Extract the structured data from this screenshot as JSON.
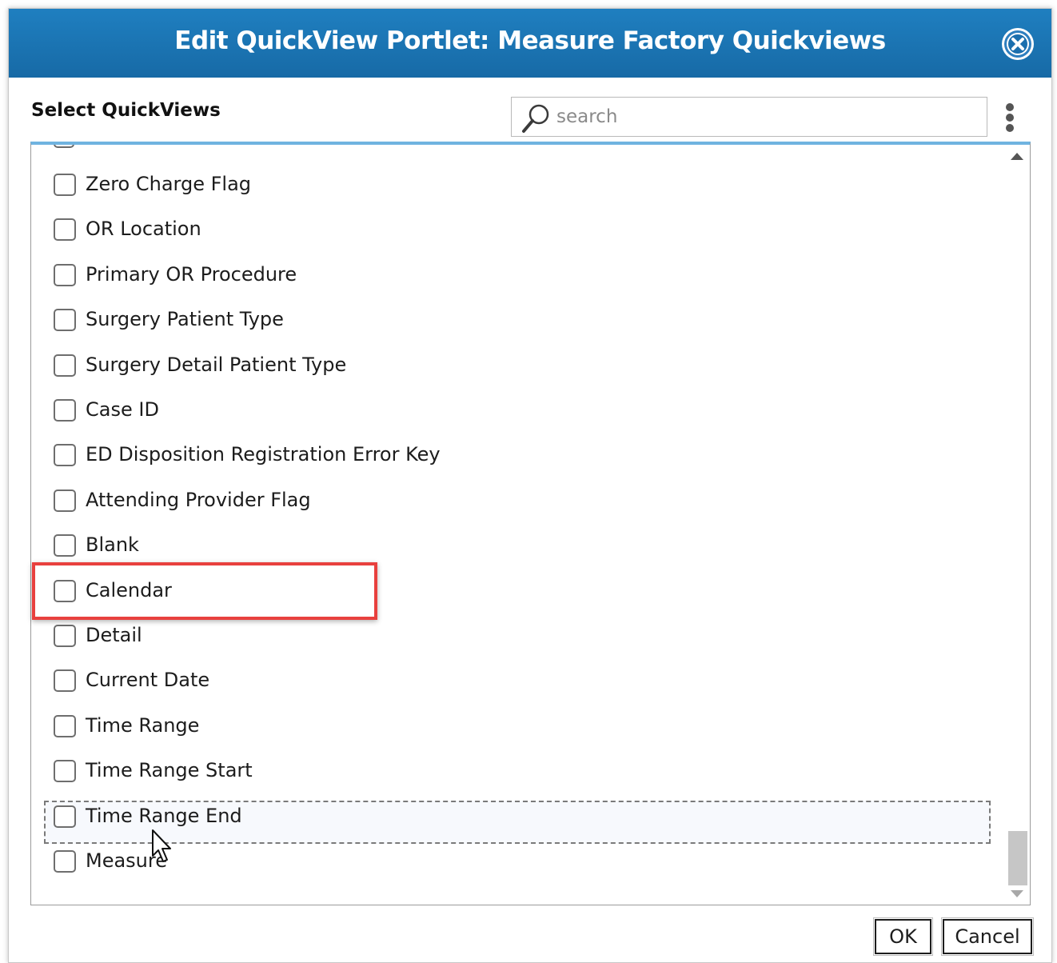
{
  "dialog": {
    "title": "Edit QuickView Portlet: Measure Factory Quickviews",
    "header_color": "#1b76b5"
  },
  "selector": {
    "label": "Select QuickViews",
    "search_placeholder": "search"
  },
  "items": [
    {
      "label": "Zero Charge Flag",
      "checked": false
    },
    {
      "label": "OR Location",
      "checked": false
    },
    {
      "label": "Primary OR Procedure",
      "checked": false
    },
    {
      "label": "Surgery Patient Type",
      "checked": false
    },
    {
      "label": "Surgery Detail Patient Type",
      "checked": false
    },
    {
      "label": "Case ID",
      "checked": false
    },
    {
      "label": "ED Disposition Registration Error Key",
      "checked": false
    },
    {
      "label": "Attending Provider Flag",
      "checked": false
    },
    {
      "label": "Blank",
      "checked": false
    },
    {
      "label": "Calendar",
      "checked": false
    },
    {
      "label": "Detail",
      "checked": false
    },
    {
      "label": "Current Date",
      "checked": false
    },
    {
      "label": "Time Range",
      "checked": false
    },
    {
      "label": "Time Range Start",
      "checked": false
    },
    {
      "label": "Time Range End",
      "checked": false
    },
    {
      "label": "Measure",
      "checked": false
    }
  ],
  "highlighted_item": "Calendar",
  "focused_item": "Time Range End",
  "highlight_color": "#e8403e",
  "buttons": {
    "ok": "OK",
    "cancel": "Cancel"
  }
}
